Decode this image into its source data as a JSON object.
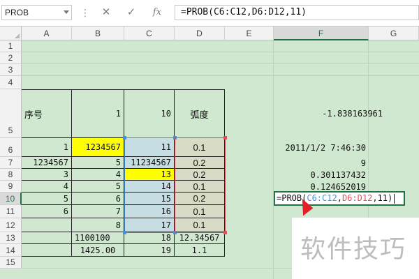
{
  "toolbar": {
    "name_box": "PROB",
    "more_icon": "⋮",
    "cancel_icon": "✕",
    "enter_icon": "✓",
    "fx_label": "fx",
    "formula": "=PROB(C6:C12,D6:D12,11)"
  },
  "columns": [
    "A",
    "B",
    "C",
    "D",
    "E",
    "F",
    "G"
  ],
  "rows": [
    "1",
    "2",
    "3",
    "4",
    "5",
    "6",
    "7",
    "8",
    "9",
    "10",
    "11",
    "12",
    "13",
    "14",
    "15"
  ],
  "cells": {
    "A5": "序号",
    "B5": "1",
    "C5": "10",
    "D5": "弧度",
    "F5": "-1.838163961",
    "A6": "1",
    "B6": "1234567",
    "C6": "11",
    "D6": "0.1",
    "F6": "2011/1/2 7:46:30",
    "A7": "1234567",
    "B7": "5",
    "C7": "11234567",
    "D7": "0.2",
    "F7": "9",
    "A8": "3",
    "B8": "4",
    "C8": "13",
    "D8": "0.2",
    "F8": "0.301137432",
    "A9": "4",
    "B9": "5",
    "C9": "14",
    "D9": "0.1",
    "F9": "0.124652019",
    "A10": "5",
    "B10": "6",
    "C10": "15",
    "D10": "0.2",
    "A11": "6",
    "B11": "7",
    "C11": "16",
    "D11": "0.1",
    "B12": "8",
    "C12": "17",
    "D12": "0.1",
    "B13": "1100100",
    "C13": "18",
    "D13": "12.34567",
    "B14": "1425.00",
    "C14": "19",
    "D14": "1.1"
  },
  "editing": {
    "prefix": "=PROB(",
    "ref1": "C6:C12",
    "sep": ",",
    "ref2": "D6:D12",
    "suffix": ",11)"
  },
  "watermark": "软件技巧",
  "colors": {
    "sheet_bg": "#cfe8cf",
    "yellow": "#ffff00",
    "ref_blue": "#4a8fd6",
    "ref_red": "#e0505a",
    "active_green": "#217346"
  }
}
